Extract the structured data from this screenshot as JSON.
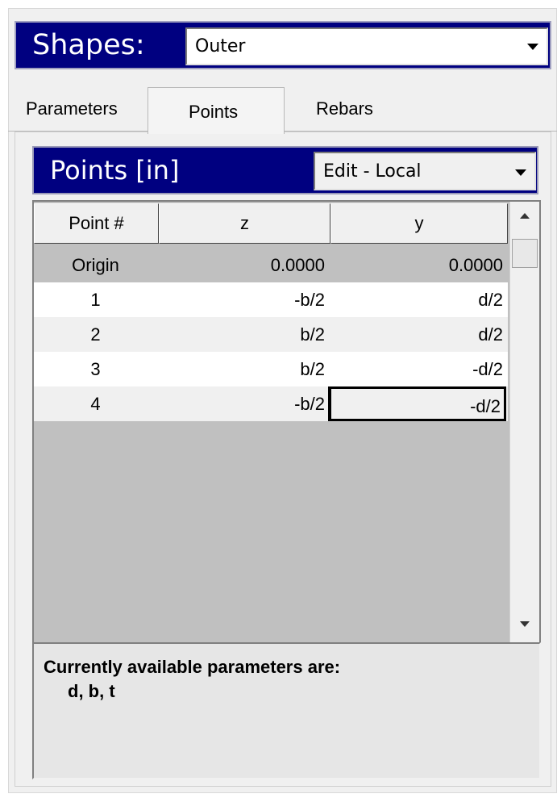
{
  "shapes": {
    "label": "Shapes:",
    "selected": "Outer"
  },
  "tabs": [
    {
      "label": "Parameters",
      "active": false
    },
    {
      "label": "Points",
      "active": true
    },
    {
      "label": "Rebars",
      "active": false
    }
  ],
  "points_panel": {
    "title": "Points [in]",
    "mode": "Edit - Local"
  },
  "grid": {
    "columns": [
      "Point #",
      "z",
      "y"
    ],
    "rows": [
      {
        "point": "Origin",
        "z": "0.0000",
        "y": "0.0000"
      },
      {
        "point": "1",
        "z": "-b/2",
        "y": "d/2"
      },
      {
        "point": "2",
        "z": "b/2",
        "y": "d/2"
      },
      {
        "point": "3",
        "z": "b/2",
        "y": "-d/2"
      },
      {
        "point": "4",
        "z": "-b/2",
        "y": "-d/2"
      }
    ]
  },
  "info": {
    "line1": "Currently available parameters are:",
    "line2": "d, b, t"
  },
  "colors": {
    "title_bar": "#000080",
    "origin_row": "#c0c0c0",
    "alt_row": "#f0f0f0",
    "empty_area": "#c0c0c0"
  }
}
